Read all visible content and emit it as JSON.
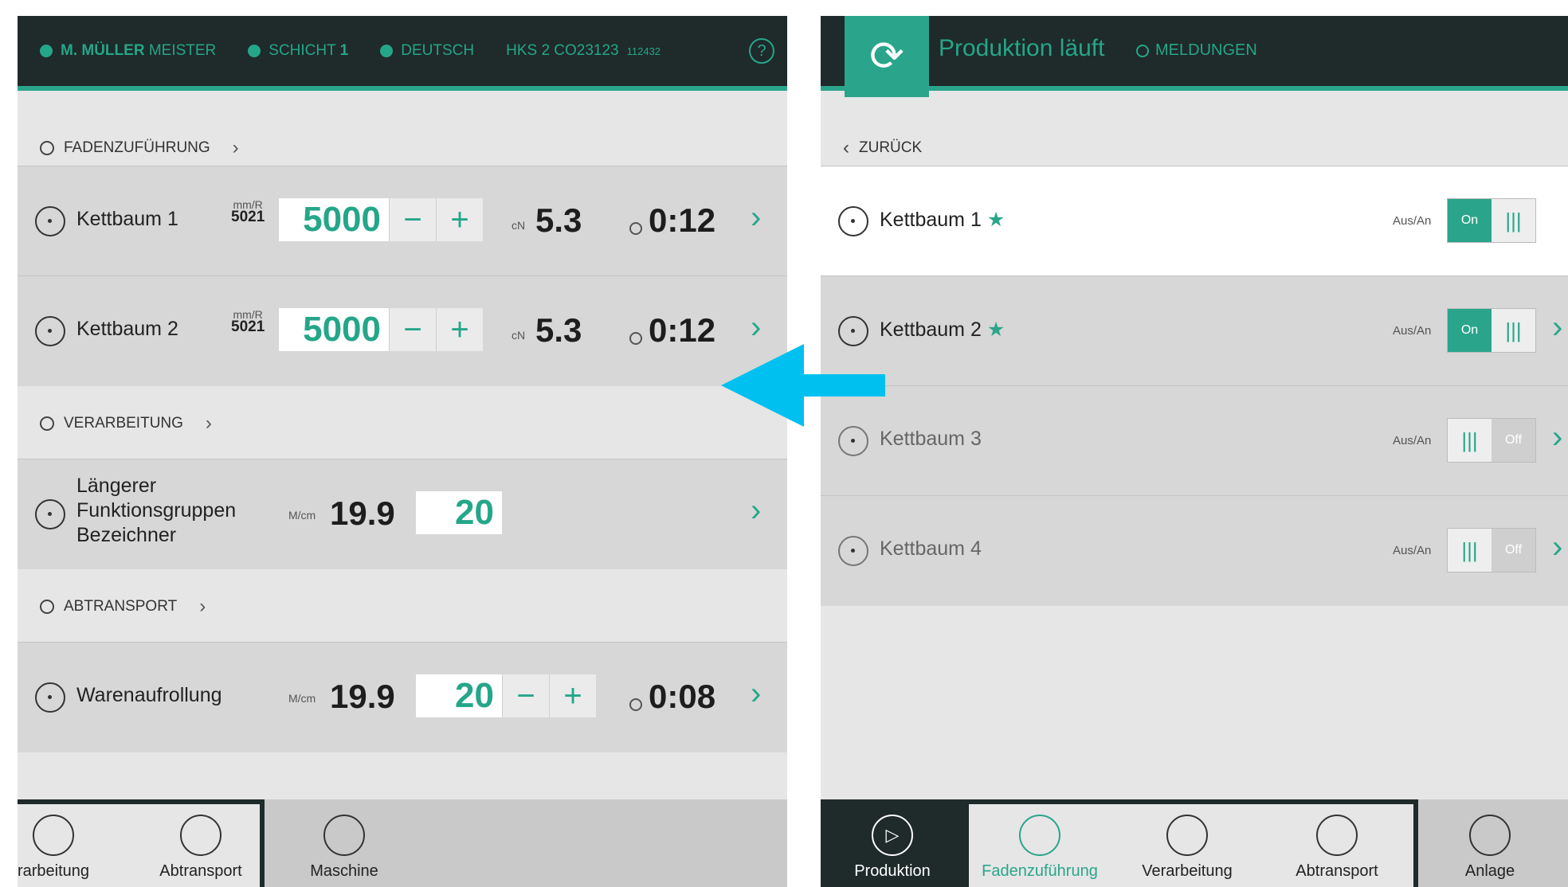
{
  "left": {
    "header": {
      "user": "M. MÜLLER",
      "role": "MEISTER",
      "shift_label": "SCHICHT",
      "shift_num": "1",
      "language": "DEUTSCH",
      "machine": "HKS 2 CO23123",
      "machine_id": "112432",
      "help": "?"
    },
    "sections": {
      "fadenzufuhrung": "FADENZUFÜHRUNG",
      "verarbeitung": "VERARBEITUNG",
      "abtransport": "ABTRANSPORT"
    },
    "rows": [
      {
        "label": "Kettbaum 1",
        "unit": "mm/R",
        "unit_val": "5021",
        "value": "5000",
        "minus": "−",
        "plus": "+",
        "force_unit": "cN",
        "force": "5.3",
        "time": "0:12"
      },
      {
        "label": "Kettbaum 2",
        "unit": "mm/R",
        "unit_val": "5021",
        "value": "5000",
        "minus": "−",
        "plus": "+",
        "force_unit": "cN",
        "force": "5.3",
        "time": "0:12"
      }
    ],
    "verarbeitung_row": {
      "label1": "Längerer",
      "label2": "Funktionsgruppen",
      "label3": "Bezeichner",
      "unit": "M/cm",
      "actual": "19.9",
      "value": "20"
    },
    "abtransport_row": {
      "label": "Warenaufrollung",
      "unit": "M/cm",
      "actual": "19.9",
      "value": "20",
      "minus": "−",
      "plus": "+",
      "time": "0:08"
    },
    "nav": [
      "rarbeitung",
      "Abtransport",
      "Maschine"
    ]
  },
  "right": {
    "title": "Produktion läuft",
    "messages": "MELDUNGEN",
    "back": "ZURÜCK",
    "toggle_label": "Aus/An",
    "rows": [
      {
        "label": "Kettbaum 1",
        "star": "★",
        "state": "On"
      },
      {
        "label": "Kettbaum 2",
        "star": "★",
        "state": "On"
      },
      {
        "label": "Kettbaum 3",
        "star": "",
        "state": "Off"
      },
      {
        "label": "Kettbaum 4",
        "star": "",
        "state": "Off"
      }
    ],
    "nav": [
      "Produktion",
      "Fadenzuführung",
      "Verarbeitung",
      "Abtransport",
      "Anlage"
    ]
  },
  "colors": {
    "accent": "#2aa58b",
    "header": "#1f2a2a",
    "arrow": "#00c0f0"
  }
}
